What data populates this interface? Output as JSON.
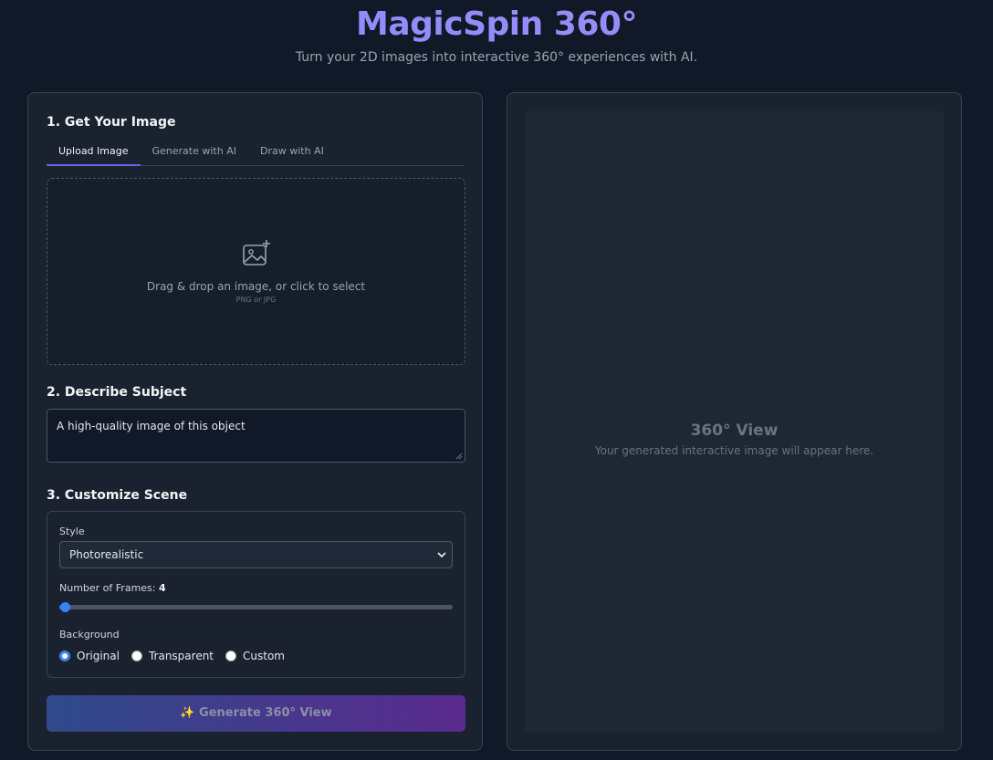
{
  "header": {
    "title": "MagicSpin 360°",
    "subtitle": "Turn your 2D images into interactive 360° experiences with AI."
  },
  "left": {
    "step1_title": "1. Get Your Image",
    "tabs": [
      {
        "label": "Upload Image",
        "active": true
      },
      {
        "label": "Generate with AI",
        "active": false
      },
      {
        "label": "Draw with AI",
        "active": false
      }
    ],
    "dropzone": {
      "icon": "image-plus-icon",
      "text": "Drag & drop an image, or click to select",
      "hint": "PNG or JPG"
    },
    "step2_title": "2. Describe Subject",
    "description_value": "A high-quality image of this object",
    "step3_title": "3. Customize Scene",
    "style_label": "Style",
    "style_selected": "Photorealistic",
    "frames_label": "Number of Frames:",
    "frames_value": "4",
    "frames_fraction": 0.0,
    "background_label": "Background",
    "background_options": [
      {
        "label": "Original",
        "checked": true
      },
      {
        "label": "Transparent",
        "checked": false
      },
      {
        "label": "Custom",
        "checked": false
      }
    ],
    "generate_label": "✨ Generate 360° View"
  },
  "right": {
    "view_title": "360° View",
    "view_subtitle": "Your generated interactive image will appear here."
  },
  "colors": {
    "accent": "#3b82f6",
    "title_gradient_start": "#818cf8",
    "title_gradient_end": "#a78bfa",
    "button_gradient_start": "#2e4a8a",
    "button_gradient_end": "#5a2a8e"
  }
}
